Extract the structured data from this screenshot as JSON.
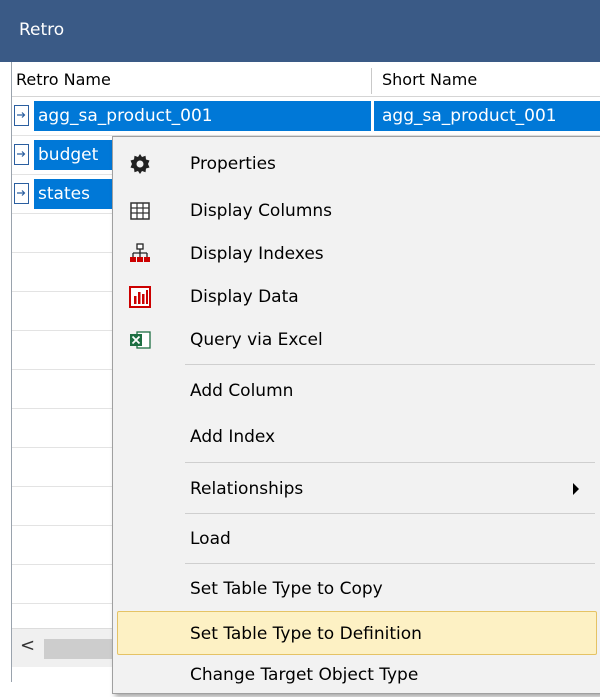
{
  "window": {
    "title": "Retro"
  },
  "columns": {
    "retro_name": "Retro Name",
    "short_name": "Short Name"
  },
  "rows": [
    {
      "name": "agg_sa_product_001",
      "short": "agg_sa_product_001"
    },
    {
      "name": "budget",
      "short": ""
    },
    {
      "name": "states",
      "short": ""
    }
  ],
  "scroll": {
    "left_arrow": "<"
  },
  "menu": {
    "items": [
      {
        "label": "Properties",
        "icon": "gear-icon"
      },
      {
        "label": "Display Columns",
        "icon": "grid-icon"
      },
      {
        "label": "Display Indexes",
        "icon": "hierarchy-icon"
      },
      {
        "label": "Display Data",
        "icon": "bar-chart-icon"
      },
      {
        "label": "Query via Excel",
        "icon": "excel-icon"
      },
      {
        "label": "Add Column"
      },
      {
        "label": "Add Index"
      },
      {
        "label": "Relationships",
        "submenu": true
      },
      {
        "label": "Load"
      },
      {
        "label": "Set Table Type to Copy"
      },
      {
        "label": "Set Table Type to Definition",
        "highlighted": true
      },
      {
        "label": "Change Target Object Type"
      }
    ]
  },
  "colors": {
    "title_bar": "#3a5a86",
    "selection": "#0078d7",
    "menu_bg": "#f2f2f2",
    "highlight": "#fdf1c4"
  }
}
